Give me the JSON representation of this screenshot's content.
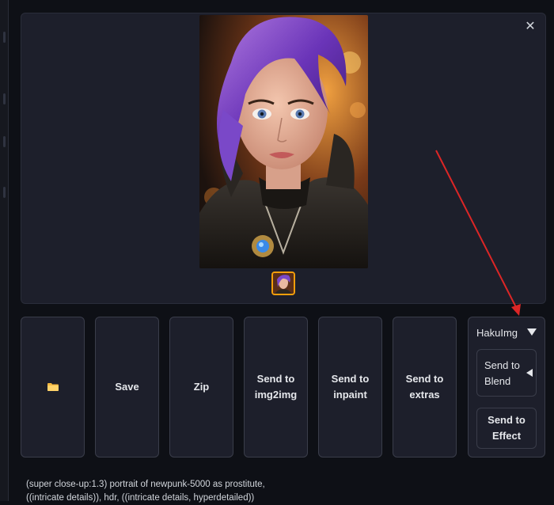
{
  "gallery": {
    "close_icon": "close-icon",
    "main_image": "portrait-image",
    "thumbnail": "portrait-thumbnail"
  },
  "actions": {
    "folder_icon": "folder-icon",
    "save_label": "Save",
    "zip_label": "Zip",
    "img2img_label": "Send to img2img",
    "inpaint_label": "Send to inpaint",
    "extras_label": "Send to extras"
  },
  "hakuimg": {
    "title": "HakuImg",
    "blend_label": "Send to Blend",
    "effect_label": "Send to Effect"
  },
  "prompt": {
    "line1": "(super close-up:1.3) portrait of newpunk-5000 as prostitute,",
    "line2": "((intricate details)), hdr, ((intricate details, hyperdetailed))"
  },
  "colors": {
    "accent": "#f59e0b",
    "annotation_arrow": "#dc2626"
  }
}
